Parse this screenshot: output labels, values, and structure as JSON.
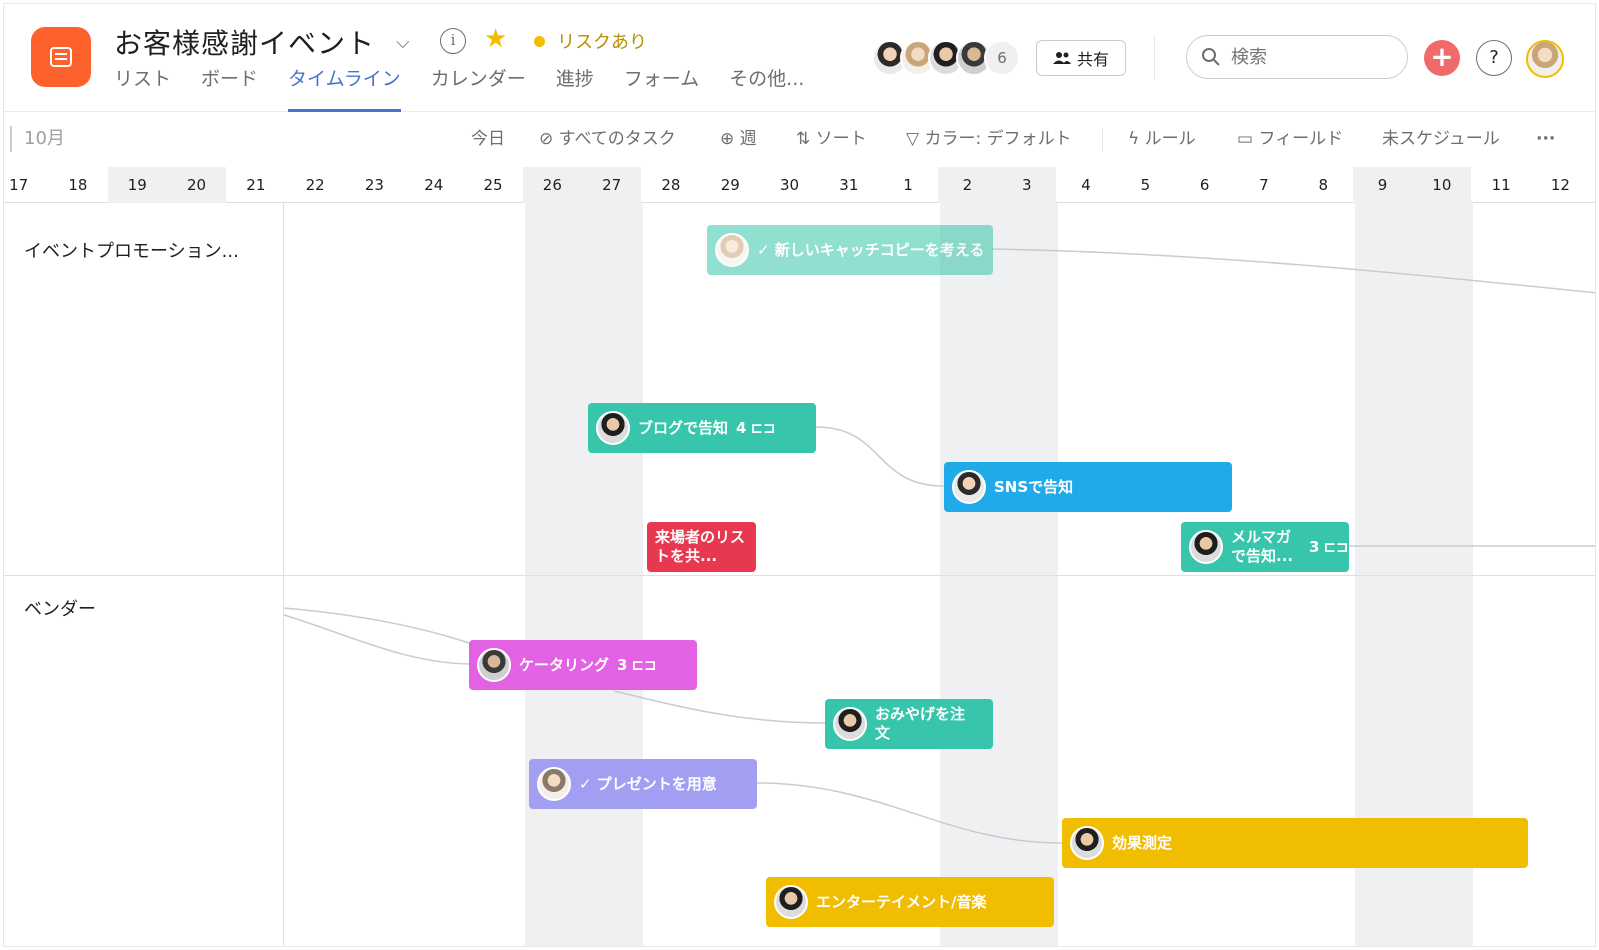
{
  "header": {
    "title": "お客様感謝イベント",
    "status": "リスクあり",
    "member_count": "6",
    "share_label": "共有",
    "search_placeholder": "検索",
    "help_label": "?",
    "add_label": "+"
  },
  "tabs": [
    {
      "label": "リスト",
      "active": false
    },
    {
      "label": "ボード",
      "active": false
    },
    {
      "label": "タイムライン",
      "active": true
    },
    {
      "label": "カレンダー",
      "active": false
    },
    {
      "label": "進捗",
      "active": false
    },
    {
      "label": "フォーム",
      "active": false
    },
    {
      "label": "その他...",
      "active": false
    }
  ],
  "toolbar": {
    "month": "10月",
    "today": "今日",
    "all_tasks": "すべてのタスク",
    "week": "週",
    "sort": "ソート",
    "color": "カラー: デフォルト",
    "rules": "ルール",
    "fields": "フィールド",
    "unscheduled": "未スケジュール",
    "more": "···"
  },
  "days": [
    "17",
    "18",
    "19",
    "20",
    "21",
    "22",
    "23",
    "24",
    "25",
    "26",
    "27",
    "28",
    "29",
    "30",
    "31",
    "1",
    "2",
    "3",
    "4",
    "5",
    "6",
    "7",
    "8",
    "9",
    "10",
    "11",
    "12"
  ],
  "lanes": [
    {
      "label": "イベントプロモーション..."
    },
    {
      "label": "ベンダー"
    }
  ],
  "tasks": [
    {
      "label": "✓ 新しいキャッチコピーを考える",
      "color": "#37c5ab",
      "faded": true,
      "subtasks": ""
    },
    {
      "label": "ブログで告知",
      "color": "#37c5ab",
      "faded": false,
      "subtasks": "4"
    },
    {
      "label": "SNSで告知",
      "color": "#20aaea",
      "faded": false,
      "subtasks": ""
    },
    {
      "label": "来場者のリストを共...",
      "color": "#e8384f",
      "faded": false,
      "subtasks": ""
    },
    {
      "label": "メルマガで告知...",
      "color": "#37c5ab",
      "faded": false,
      "subtasks": "3"
    },
    {
      "label": "ケータリング",
      "color": "#e362e3",
      "faded": false,
      "subtasks": "3"
    },
    {
      "label": "おみやげを注文",
      "color": "#37c5ab",
      "faded": false,
      "subtasks": ""
    },
    {
      "label": "✓ プレゼントを用意",
      "color": "#a29ef2",
      "faded": false,
      "subtasks": ""
    },
    {
      "label": "効果測定",
      "color": "#f1bd00",
      "faded": false,
      "subtasks": ""
    },
    {
      "label": "エンターテイメント/音楽",
      "color": "#f1bd00",
      "faded": false,
      "subtasks": ""
    }
  ],
  "colors": {
    "brand": "#fd612c",
    "accent": "#4573d2",
    "status": "#f1bd00"
  }
}
